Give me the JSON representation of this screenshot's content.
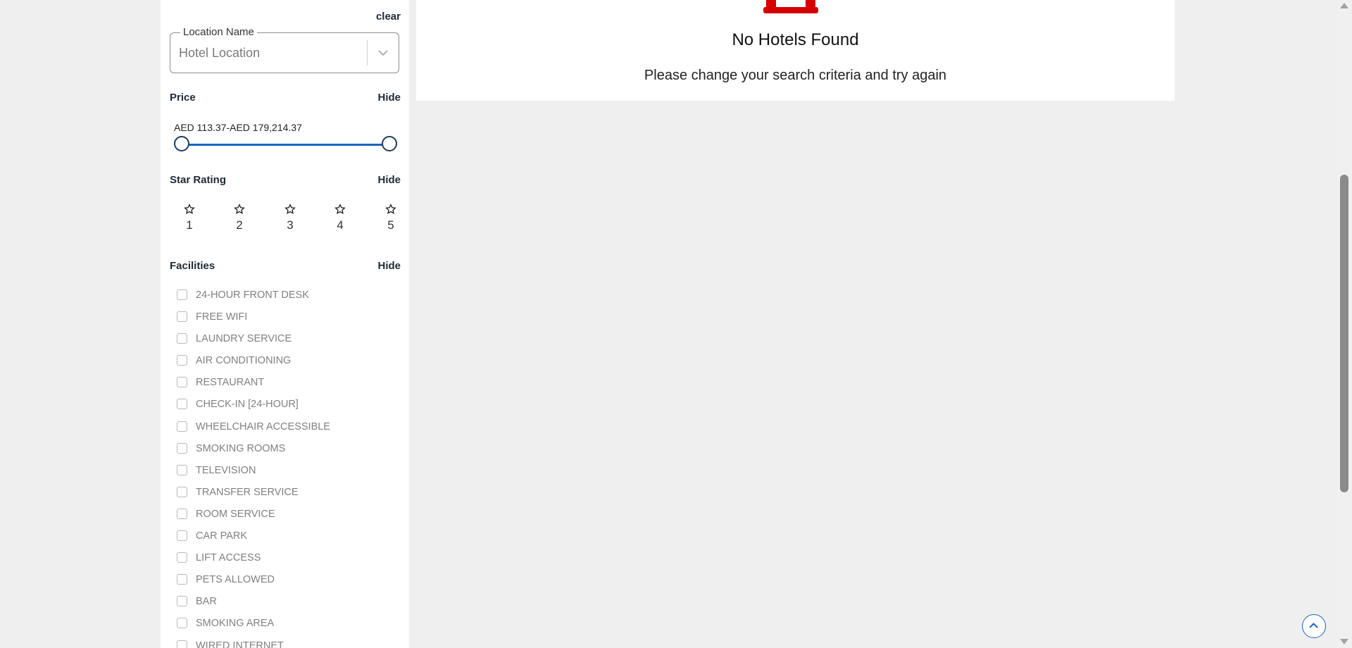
{
  "filters": {
    "clear_label": "clear",
    "location": {
      "label": "Location Name",
      "placeholder": "Hotel Location"
    },
    "price": {
      "title": "Price",
      "hide_label": "Hide",
      "range_text": "AED 113.37-AED 179,214.37",
      "range_min_fraction": 0.0,
      "range_max_fraction": 1.0
    },
    "star_rating": {
      "title": "Star Rating",
      "hide_label": "Hide",
      "options": [
        "1",
        "2",
        "3",
        "4",
        "5"
      ]
    },
    "facilities": {
      "title": "Facilities",
      "hide_label": "Hide",
      "items": [
        "24-HOUR FRONT DESK",
        "FREE WIFI",
        "LAUNDRY SERVICE",
        "AIR CONDITIONING",
        "RESTAURANT",
        "CHECK-IN [24-HOUR]",
        "WHEELCHAIR ACCESSIBLE",
        "SMOKING ROOMS",
        "TELEVISION",
        "TRANSFER SERVICE",
        "ROOM SERVICE",
        "CAR PARK",
        "LIFT ACCESS",
        "PETS ALLOWED",
        "BAR",
        "SMOKING AREA",
        "WIRED INTERNET"
      ]
    }
  },
  "results": {
    "title": "No Hotels Found",
    "message": "Please change your search criteria and try again"
  },
  "colors": {
    "accent": "#1565c0",
    "hotel_icon": "#d50000",
    "page_bg": "#efefef"
  },
  "icons": {
    "hotel": "hotel-icon",
    "star": "star-outline-icon",
    "chevron": "chevron-down-icon",
    "back_to_top": "chevron-up-icon"
  }
}
